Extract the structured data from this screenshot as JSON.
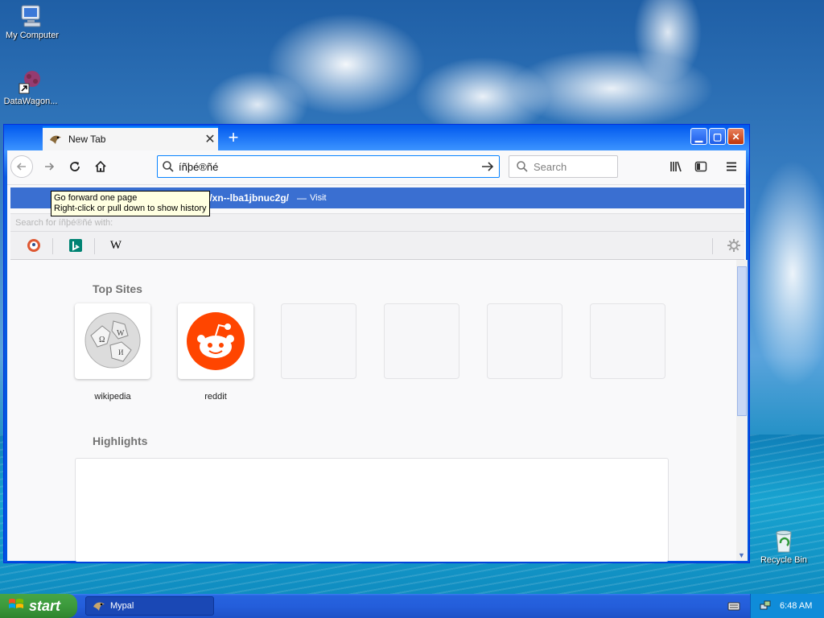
{
  "desktop": {
    "icons": [
      {
        "label": "My Computer"
      },
      {
        "label": "DataWagon..."
      },
      {
        "label": "Recycle Bin"
      }
    ]
  },
  "window": {
    "tab": {
      "title": "New Tab"
    },
    "url": {
      "value": "íñþé®ñé"
    },
    "search": {
      "placeholder": "Search"
    },
    "suggestion": {
      "url": "//xn--lba1jbnuc2g/",
      "separator": "—",
      "visit": "Visit"
    },
    "tooltip": {
      "line1": "Go forward one page",
      "line2": "Right-click or pull down to show history"
    },
    "search_with": "Search for íñþé®ñé with:",
    "engines": [
      "DuckDuckGo",
      "Bing",
      "Wikipedia"
    ],
    "top_sites": {
      "title": "Top Sites",
      "tiles": [
        {
          "label": "wikipedia",
          "icon": "wikipedia-globe-icon"
        },
        {
          "label": "reddit",
          "icon": "reddit-alien-icon"
        }
      ]
    },
    "highlights": {
      "title": "Highlights"
    }
  },
  "taskbar": {
    "start": "start",
    "task": "Mypal",
    "clock": "6:48 AM"
  }
}
